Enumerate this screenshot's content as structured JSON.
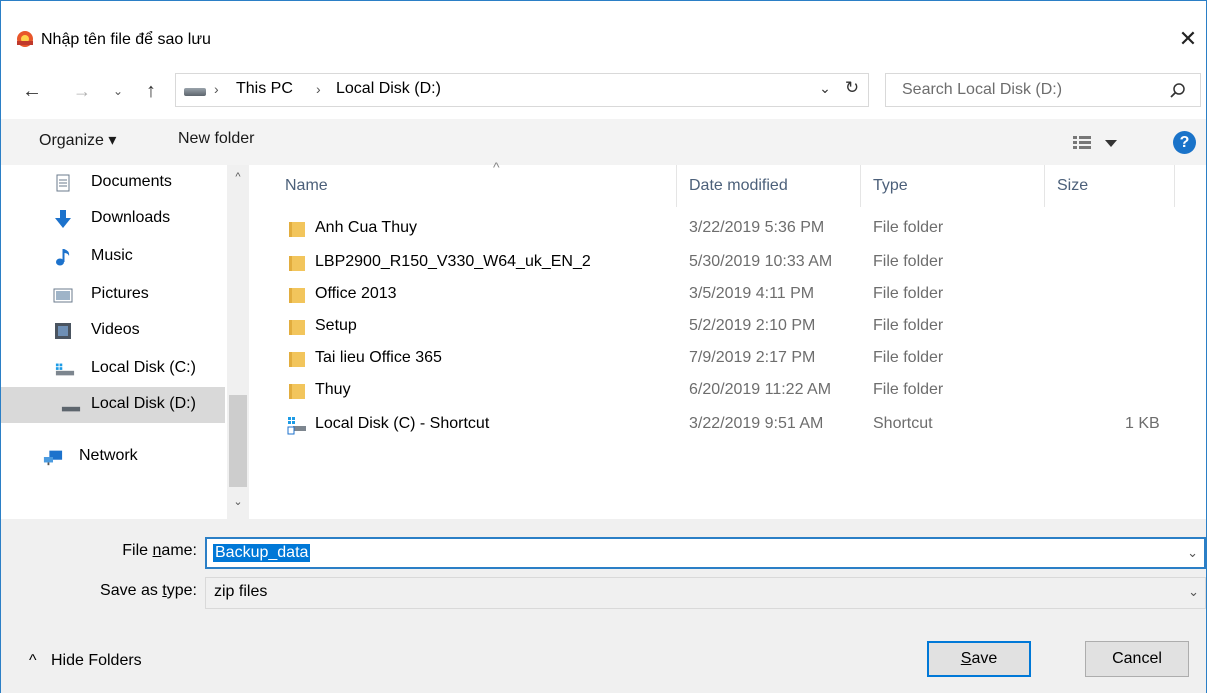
{
  "window": {
    "title": "Nhập tên file để sao lưu",
    "close_glyph": "✕"
  },
  "nav": {
    "back_glyph": "←",
    "forward_glyph": "→",
    "recent_glyph": "⌄",
    "up_glyph": "↑",
    "breadcrumb_sep": "›",
    "breadcrumb": [
      "This PC",
      "Local Disk (D:)"
    ],
    "dropdown_glyph": "⌄",
    "refresh_glyph": "↻"
  },
  "search": {
    "placeholder": "Search Local Disk (D:)"
  },
  "toolbar": {
    "organize_label": "Organize ▾",
    "new_folder_label": "New folder",
    "help_label": "?"
  },
  "navpane": {
    "items": [
      {
        "label": "Documents",
        "icon": "documents-icon"
      },
      {
        "label": "Downloads",
        "icon": "downloads-icon"
      },
      {
        "label": "Music",
        "icon": "music-icon"
      },
      {
        "label": "Pictures",
        "icon": "pictures-icon"
      },
      {
        "label": "Videos",
        "icon": "videos-icon"
      },
      {
        "label": "Local Disk (C:)",
        "icon": "drive-c-icon"
      },
      {
        "label": "Local Disk (D:)",
        "icon": "drive-d-icon",
        "selected": true
      },
      {
        "label": "Network",
        "icon": "network-icon"
      }
    ],
    "scroll_up_glyph": "^",
    "scroll_down_glyph": "⌄"
  },
  "filelist": {
    "columns": [
      "Name",
      "Date modified",
      "Type",
      "Size"
    ],
    "sort_glyph": "^",
    "rows": [
      {
        "name": "Anh Cua Thuy",
        "date": "3/22/2019 5:36 PM",
        "type": "File folder",
        "size": "",
        "icon": "folder-icon"
      },
      {
        "name": "LBP2900_R150_V330_W64_uk_EN_2",
        "date": "5/30/2019 10:33 AM",
        "type": "File folder",
        "size": "",
        "icon": "folder-icon"
      },
      {
        "name": "Office 2013",
        "date": "3/5/2019 4:11 PM",
        "type": "File folder",
        "size": "",
        "icon": "folder-icon"
      },
      {
        "name": "Setup",
        "date": "5/2/2019 2:10 PM",
        "type": "File folder",
        "size": "",
        "icon": "folder-icon"
      },
      {
        "name": "Tai lieu Office 365",
        "date": "7/9/2019 2:17 PM",
        "type": "File folder",
        "size": "",
        "icon": "folder-icon"
      },
      {
        "name": "Thuy",
        "date": "6/20/2019 11:22 AM",
        "type": "File folder",
        "size": "",
        "icon": "folder-icon"
      },
      {
        "name": "Local Disk (C) - Shortcut",
        "date": "3/22/2019 9:51 AM",
        "type": "Shortcut",
        "size": "1 KB",
        "icon": "shortcut-icon"
      }
    ]
  },
  "form": {
    "filename_label_pre": "File ",
    "filename_label_ul": "n",
    "filename_label_post": "ame:",
    "filename_value": "Backup_data",
    "savetype_label_pre": "Save as ",
    "savetype_label_ul": "t",
    "savetype_label_post": "ype:",
    "savetype_value": "zip files",
    "dropdown_glyph": "⌄"
  },
  "footer": {
    "hide_folders_glyph": "^",
    "hide_folders_label": "Hide Folders",
    "save_label_ul": "S",
    "save_label_rest": "ave",
    "cancel_label": "Cancel"
  },
  "colors": {
    "accent": "#0078d7",
    "folder": "#f2c55c",
    "selected_row": "#d9d9d9"
  }
}
